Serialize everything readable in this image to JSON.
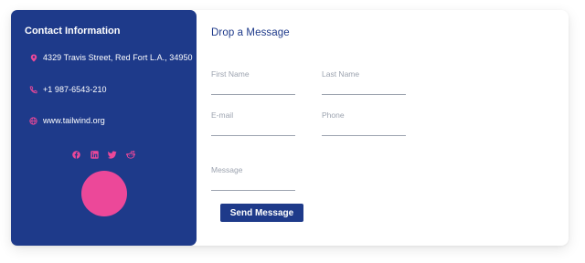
{
  "contact": {
    "title": "Contact Information",
    "address": "4329 Travis Street, Red Fort L.A., 34950",
    "phone": "+1 987-6543-210",
    "website": "www.tailwind.org",
    "socials": [
      "facebook",
      "linkedin",
      "twitter",
      "reddit"
    ]
  },
  "form": {
    "title": "Drop a Message",
    "first_name_label": "First Name",
    "last_name_label": "Last Name",
    "email_label": "E-mail",
    "phone_label": "Phone",
    "message_label": "Message",
    "send_label": "Send Message"
  },
  "colors": {
    "panel": "#1e3a8a",
    "accent": "#ec4899",
    "button": "#1e3a8a"
  }
}
